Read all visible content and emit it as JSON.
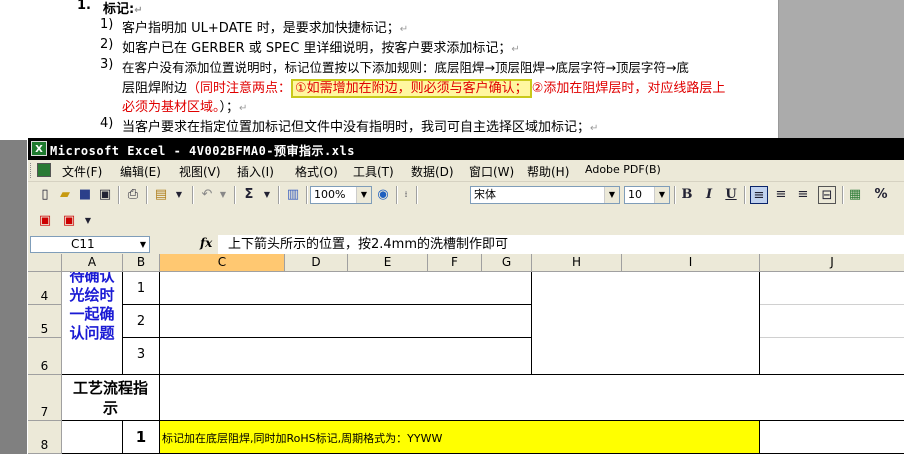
{
  "word": {
    "heading_num": "1.",
    "heading": "标记:",
    "items": [
      {
        "num": "1)",
        "text": "客户指明加 UL+DATE 时，是要求加快捷标记；"
      },
      {
        "num": "2)",
        "text": "如客户已在 GERBER 或 SPEC 里详细说明，按客户要求添加标记；"
      },
      {
        "num": "3)",
        "text": "在客户没有添加位置说明时，标记位置按以下添加规则：底层阻焊→顶层阻焊→底层字符→顶层字符→底"
      },
      {
        "num": "4)",
        "text": "当客户要求在指定位置加标记但文件中没有指明时，我司可自主选择区域加标记；"
      }
    ],
    "item3_line2_black": "层阻焊附边",
    "item3_line2_red": "（同时注意两点：",
    "item3_highlight": "①如需增加在附边，则必须与客户确认；",
    "item3_line2_red2": "②添加在阻焊层时，对应线路层上",
    "item3_line3_red": "必须为基材区域。",
    "item3_line3_end": "）；",
    "para_mark": "↵"
  },
  "excel": {
    "title": "Microsoft Excel - 4V002BFMA0-预审指示.xls",
    "menu": [
      "文件(F)",
      "编辑(E)",
      "视图(V)",
      "插入(I)",
      "格式(O)",
      "工具(T)",
      "数据(D)",
      "窗口(W)",
      "帮助(H)",
      "Adobe PDF(B)"
    ],
    "toolbar": {
      "zoom": "100%",
      "font": "宋体",
      "size": "10",
      "sigma": "Σ",
      "bold": "B",
      "italic": "I",
      "underline": "U",
      "percent": "%"
    },
    "namebox": "C11",
    "fx": "fx",
    "formula": "上下箭头所示的位置，按2.4mm的洗槽制作即可",
    "columns": [
      "A",
      "B",
      "C",
      "D",
      "E",
      "F",
      "G",
      "H",
      "I",
      "J"
    ],
    "rows": [
      "4",
      "5",
      "6",
      "7",
      "8"
    ],
    "cells": {
      "a4_6": "待确认光绘时一起确认问题",
      "b4": "1",
      "b5": "2",
      "b6": "3",
      "a7": "工艺流程指示",
      "b8": "1",
      "c8": "标记加在底层阻焊,同时加RoHS标记,周期格式为：YYWW"
    },
    "colors": {
      "titlebar": "#000000",
      "selected_header": "#ffc871",
      "blue_text": "#1a1ad4",
      "highlight_yellow": "#ffff00"
    }
  }
}
